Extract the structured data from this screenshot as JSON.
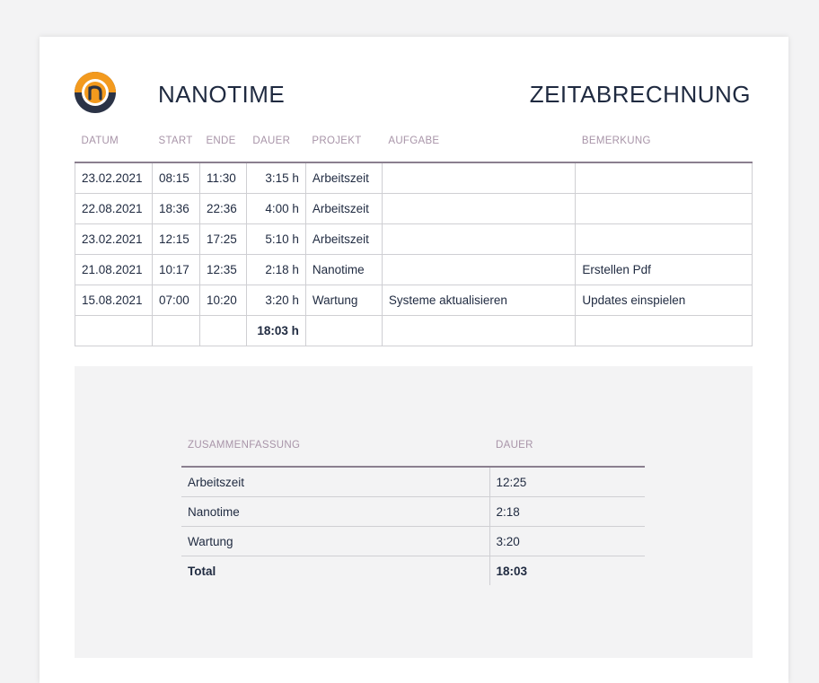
{
  "header": {
    "brand": "NANOTIME",
    "title": "ZEITABRECHNUNG"
  },
  "colors": {
    "logo_orange": "#f39a1e",
    "logo_dark": "#2b3346",
    "accent_header": "#a894a8"
  },
  "table": {
    "columns": [
      "DATUM",
      "START",
      "ENDE",
      "DAUER",
      "PROJEKT",
      "AUFGABE",
      "BEMERKUNG"
    ],
    "rows": [
      {
        "datum": "23.02.2021",
        "start": "08:15",
        "ende": "11:30",
        "dauer": "3:15 h",
        "projekt": "Arbeitszeit",
        "aufgabe": "",
        "bemerkung": ""
      },
      {
        "datum": "22.08.2021",
        "start": "18:36",
        "ende": "22:36",
        "dauer": "4:00 h",
        "projekt": "Arbeitszeit",
        "aufgabe": "",
        "bemerkung": ""
      },
      {
        "datum": "23.02.2021",
        "start": "12:15",
        "ende": "17:25",
        "dauer": "5:10 h",
        "projekt": "Arbeitszeit",
        "aufgabe": "",
        "bemerkung": ""
      },
      {
        "datum": "21.08.2021",
        "start": "10:17",
        "ende": "12:35",
        "dauer": "2:18 h",
        "projekt": "Nanotime",
        "aufgabe": "",
        "bemerkung": "Erstellen Pdf"
      },
      {
        "datum": "15.08.2021",
        "start": "07:00",
        "ende": "10:20",
        "dauer": "3:20 h",
        "projekt": "Wartung",
        "aufgabe": "Systeme aktualisieren",
        "bemerkung": "Updates einspielen"
      }
    ],
    "total_dauer": "18:03 h"
  },
  "summary": {
    "columns": [
      "ZUSAMMENFASSUNG",
      "DAUER"
    ],
    "rows": [
      {
        "name": "Arbeitszeit",
        "dauer": "12:25"
      },
      {
        "name": "Nanotime",
        "dauer": "2:18"
      },
      {
        "name": "Wartung",
        "dauer": "3:20"
      }
    ],
    "total": {
      "name": "Total",
      "dauer": "18:03"
    }
  }
}
